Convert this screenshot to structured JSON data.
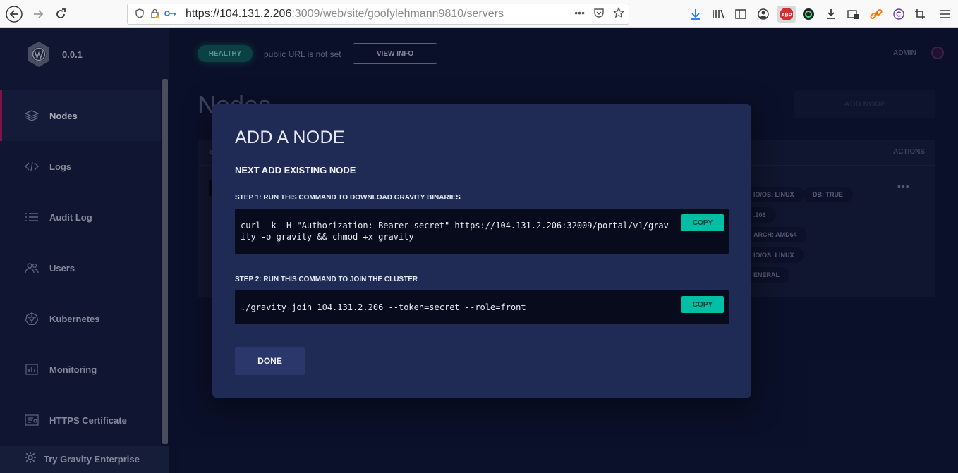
{
  "browser": {
    "url_host": "https://104.131.2.206",
    "url_path": ":3009/web/site/goofylehmann9810/servers",
    "adblock_label": "ABP"
  },
  "sidebar": {
    "version": "0.0.1",
    "items": [
      {
        "label": "Nodes",
        "icon": "layers-icon",
        "active": true
      },
      {
        "label": "Logs",
        "icon": "code-icon",
        "active": false
      },
      {
        "label": "Audit Log",
        "icon": "list-icon",
        "active": false
      },
      {
        "label": "Users",
        "icon": "users-icon",
        "active": false
      },
      {
        "label": "Kubernetes",
        "icon": "kubernetes-icon",
        "active": false
      },
      {
        "label": "Monitoring",
        "icon": "chart-icon",
        "active": false
      },
      {
        "label": "HTTPS Certificate",
        "icon": "certificate-icon",
        "active": false
      }
    ],
    "enterprise_label": "Try Gravity Enterprise"
  },
  "header": {
    "status_badge": "HEALTHY",
    "public_url_text": "public URL is not set",
    "view_info_label": "VIEW INFO",
    "user_label": "ADMIN"
  },
  "page": {
    "title": "Nodes",
    "add_node_label": "ADD NODE",
    "table": {
      "first_header": "S",
      "actions_header": "ACTIONS",
      "row_menu": "•••",
      "labels": [
        "IO/OS: LINUX",
        "DB: TRUE",
        ".206",
        "ARCH: AMD64",
        "IO/OS: LINUX",
        "ENERAL"
      ]
    }
  },
  "modal": {
    "title": "ADD A NODE",
    "subtitle": "NEXT ADD EXISTING NODE",
    "step1_label": "STEP 1: RUN THIS COMMAND TO DOWNLOAD GRAVITY BINARIES",
    "step1_command_line1": "curl -k -H \"Authorization: Bearer secret\" https://104.131.2.206:32009/portal/v1/grav",
    "step1_command_line2": "ity -o gravity && chmod +x gravity",
    "step2_label": "STEP 2: RUN THIS COMMAND TO JOIN THE CLUSTER",
    "step2_command": "./gravity join 104.131.2.206 --token=secret --role=front",
    "copy_label": "COPY",
    "done_label": "DONE"
  },
  "colors": {
    "accent_teal": "#00bfa5",
    "active_marker": "#c2185b",
    "modal_bg": "#1f2a55"
  }
}
